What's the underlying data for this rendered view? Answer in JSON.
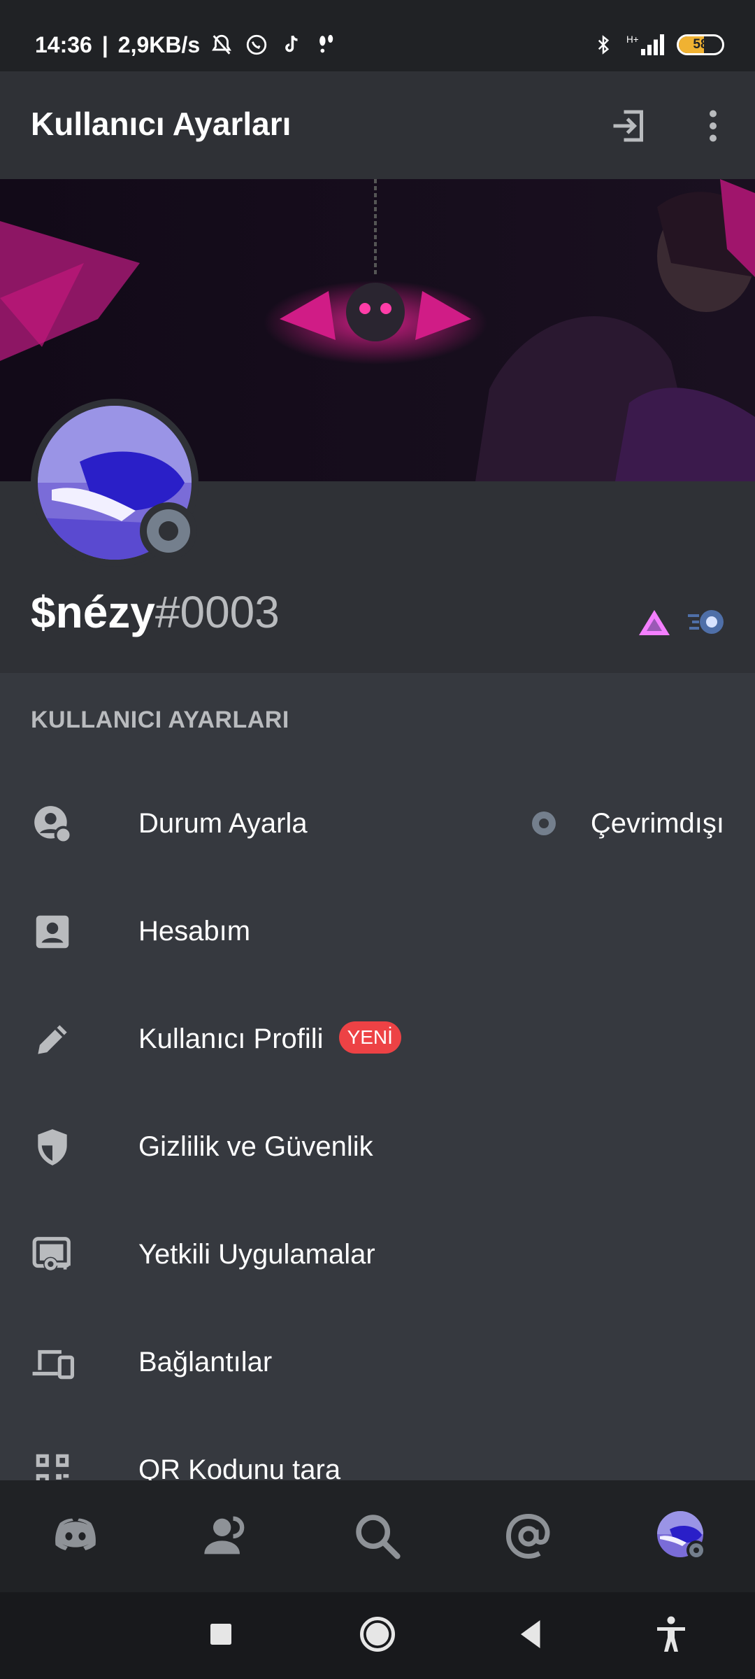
{
  "status_bar": {
    "time": "14:36",
    "separator": "|",
    "speed": "2,9KB/s",
    "battery_level": "58",
    "battery_fraction": 0.58,
    "icons": [
      "mute-bell-icon",
      "whatsapp-icon",
      "tiktok-icon",
      "footsteps-icon",
      "bluetooth-icon",
      "signal-icon",
      "battery-icon"
    ]
  },
  "app_bar": {
    "title": "Kullanıcı Ayarları",
    "icons": [
      "logout-icon",
      "more-vertical-icon"
    ]
  },
  "profile": {
    "username": "$nézy",
    "discriminator": "#0003",
    "status": "offline",
    "badges": [
      "hypesquad-badge-icon",
      "nitro-boost-badge-icon"
    ]
  },
  "settings": {
    "section_title": "KULLANICI AYARLARI",
    "items": [
      {
        "label": "Durum Ayarla",
        "icon": "status-icon",
        "value": "Çevrimdışı"
      },
      {
        "label": "Hesabım",
        "icon": "account-icon"
      },
      {
        "label": "Kullanıcı Profili",
        "icon": "pencil-icon",
        "badge": "YENİ"
      },
      {
        "label": "Gizlilik ve Güvenlik",
        "icon": "shield-icon"
      },
      {
        "label": "Yetkili Uygulamalar",
        "icon": "authorized-apps-icon"
      },
      {
        "label": "Bağlantılar",
        "icon": "devices-icon"
      },
      {
        "label": "QR Kodunu tara",
        "icon": "qr-code-icon"
      }
    ]
  },
  "bottom_nav": {
    "items": [
      "discord-home-icon",
      "friends-icon",
      "search-icon",
      "mentions-icon",
      "profile-avatar"
    ]
  },
  "system_nav": {
    "items": [
      "recents-icon",
      "home-icon",
      "back-icon",
      "accessibility-icon"
    ]
  },
  "colors": {
    "background": "#36393f",
    "header": "#2f3136",
    "nav": "#202225",
    "accent_red": "#ed4245",
    "offline_gray": "#747f8d",
    "banner_magenta": "#c2187a"
  }
}
